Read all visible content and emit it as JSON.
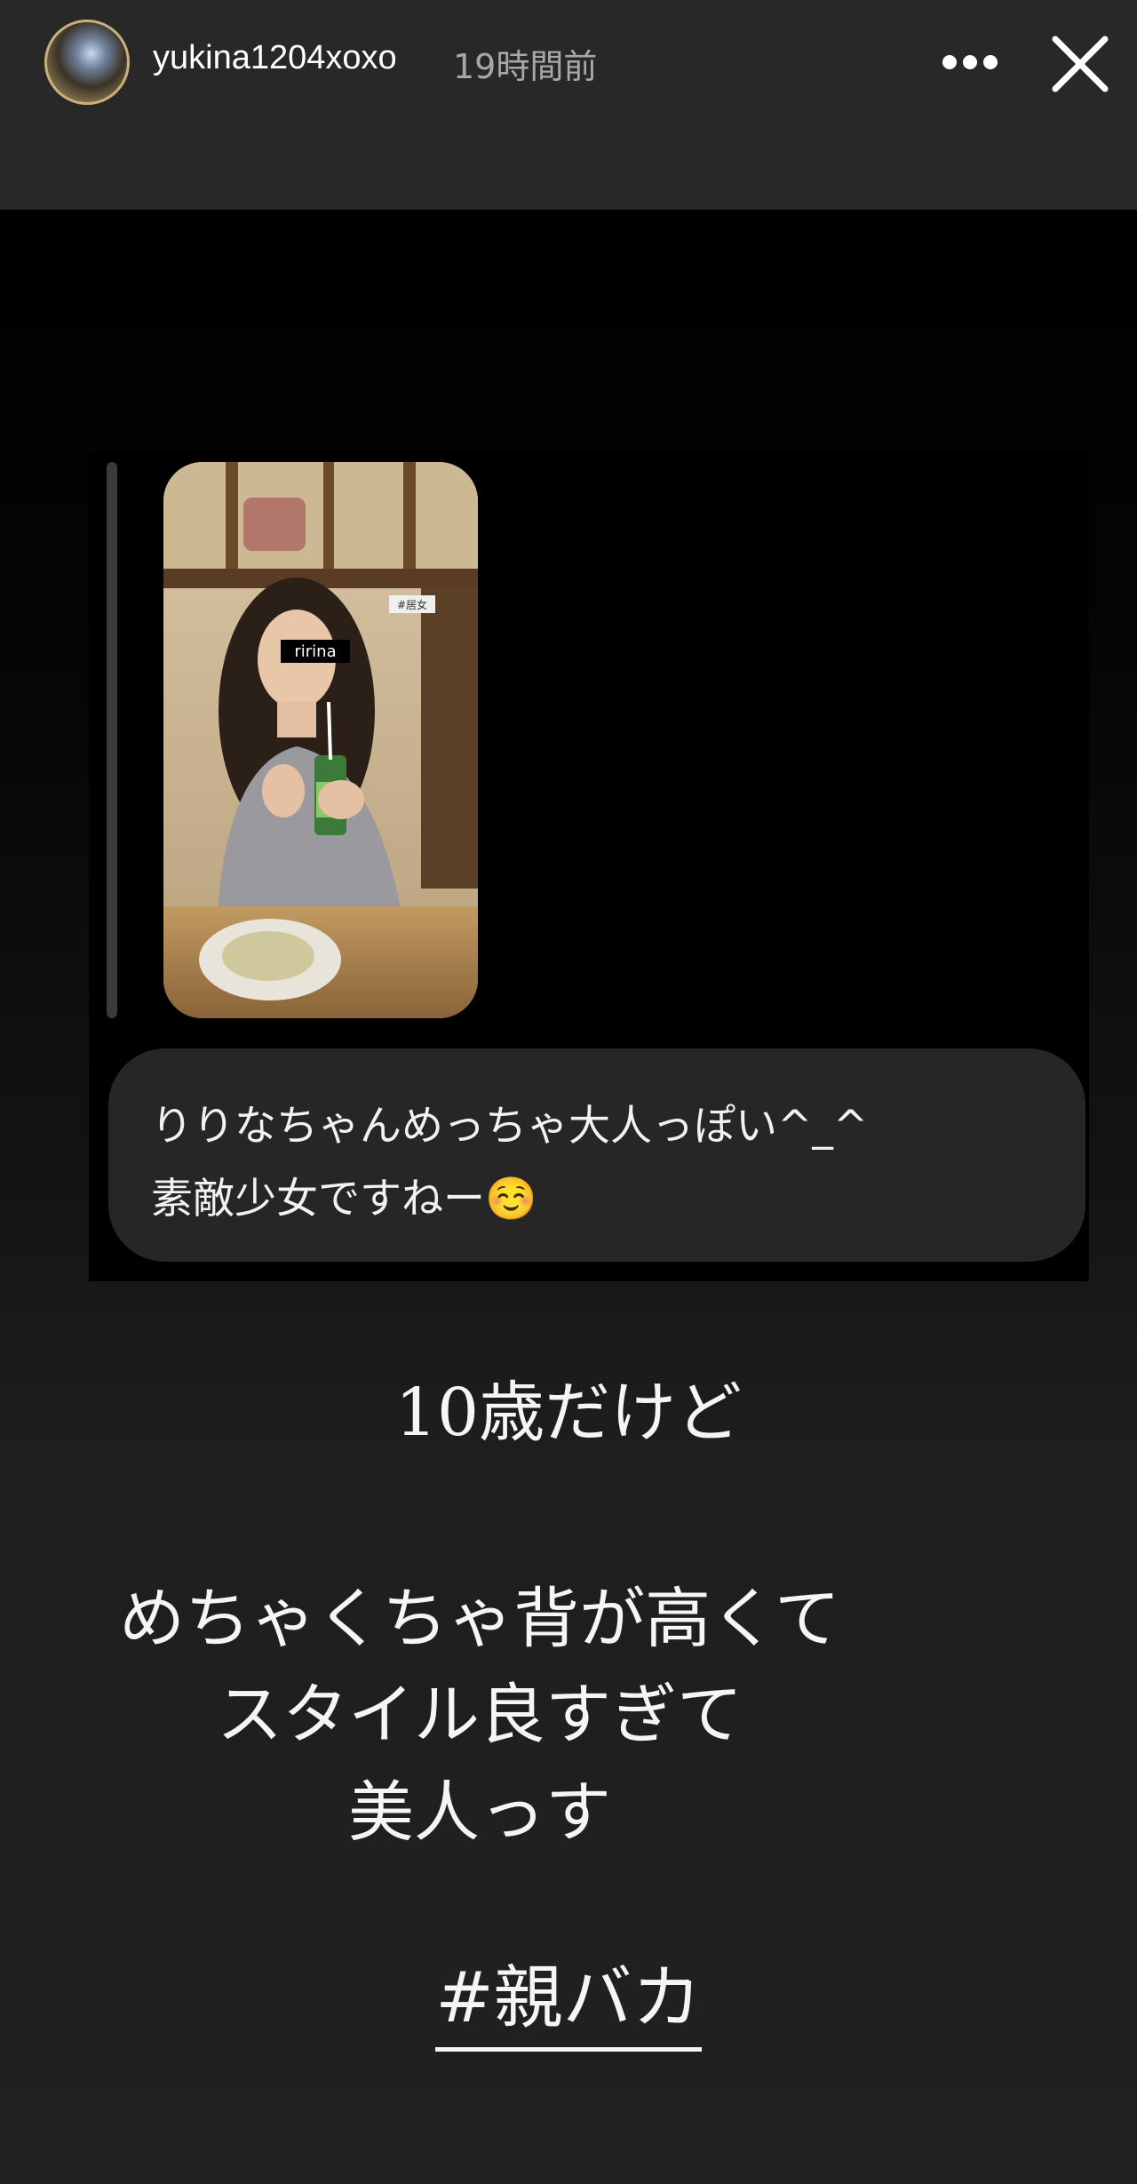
{
  "header": {
    "username": "yukina1204xoxo",
    "time_ago": "19時間前",
    "more_icon": "more-horizontal-icon",
    "close_icon": "close-icon"
  },
  "embedded_screenshot": {
    "thumbnail": {
      "name_sticker": "ririna",
      "corner_tag": "#居女"
    },
    "reply": {
      "line1": "りりなちゃんめっちゃ大人っぽい^_^",
      "line2": "素敵少女ですねー☺️"
    }
  },
  "caption": {
    "line1": "10歳だけど",
    "line2": "めちゃくちゃ背が高くて",
    "line3": "スタイル良すぎて",
    "line4": "美人っす",
    "hashtag": "#親バカ"
  }
}
